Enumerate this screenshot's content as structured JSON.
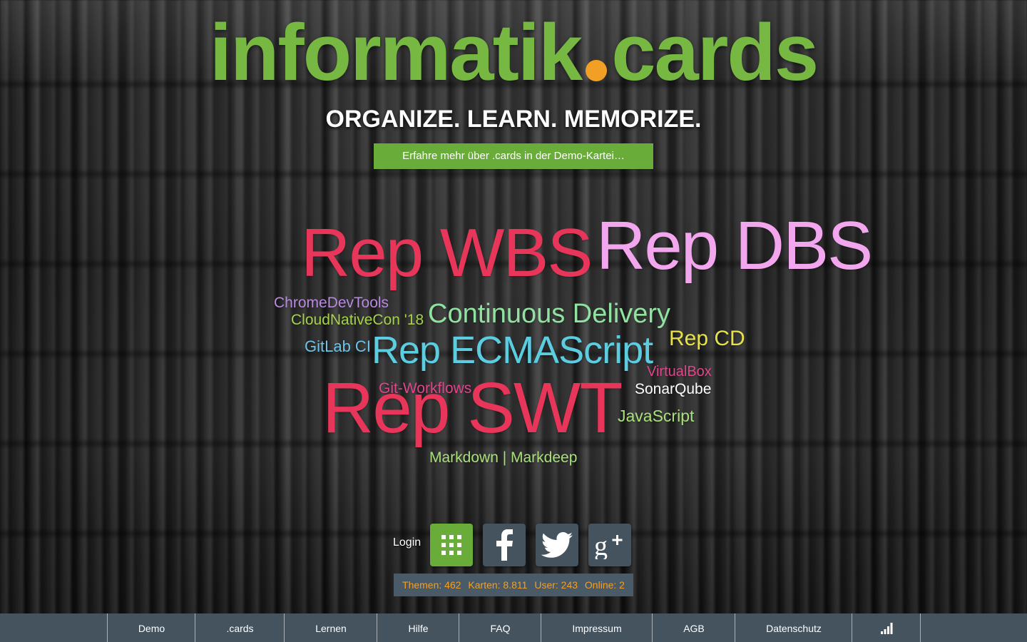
{
  "brand": {
    "name_left": "informatik",
    "name_right": "cards",
    "slogan": "ORGANIZE. LEARN. MEMORIZE.",
    "demo_button": "Erfahre mehr über .cards in der Demo-Kartei…",
    "colors": {
      "green": "#76b842",
      "orange": "#f2a025",
      "bar": "#44535e"
    }
  },
  "tag_cloud": [
    {
      "text": "Rep WBS",
      "color": "#e8355a"
    },
    {
      "text": "Rep DBS",
      "color": "#f2a6ee"
    },
    {
      "text": "ChromeDevTools",
      "color": "#b88ae0"
    },
    {
      "text": "CloudNativeCon '18",
      "color": "#a6d24a"
    },
    {
      "text": "Continuous Delivery",
      "color": "#8fe2a0"
    },
    {
      "text": "GitLab CI",
      "color": "#6ec4e8"
    },
    {
      "text": "Rep ECMAScript",
      "color": "#5ccde0"
    },
    {
      "text": "Rep CD",
      "color": "#e8e24a"
    },
    {
      "text": "VirtualBox",
      "color": "#e0458a"
    },
    {
      "text": "Git-Workflows",
      "color": "#e0458a"
    },
    {
      "text": "SonarQube",
      "color": "#ffffff"
    },
    {
      "text": "Rep SWT",
      "color": "#e8355a"
    },
    {
      "text": "JavaScript",
      "color": "#a8e07a"
    },
    {
      "text": "Markdown | Markdeep",
      "color": "#a8e07a"
    }
  ],
  "login": {
    "label": "Login",
    "icons": [
      {
        "name": "grid-login-icon",
        "bg": "#6aac3a"
      },
      {
        "name": "facebook-icon",
        "bg": "#44535e"
      },
      {
        "name": "twitter-icon",
        "bg": "#44535e"
      },
      {
        "name": "google-plus-icon",
        "bg": "#44535e"
      }
    ]
  },
  "stats": {
    "topics": "Themen: 462",
    "cards": "Karten: 8.811",
    "users": "User: 243",
    "online": "Online: 2"
  },
  "footer": {
    "items": [
      "Demo",
      ".cards",
      "Lernen",
      "Hilfe",
      "FAQ",
      "Impressum",
      "AGB",
      "Datenschutz"
    ],
    "signal_icon": "signal-bars-icon"
  }
}
